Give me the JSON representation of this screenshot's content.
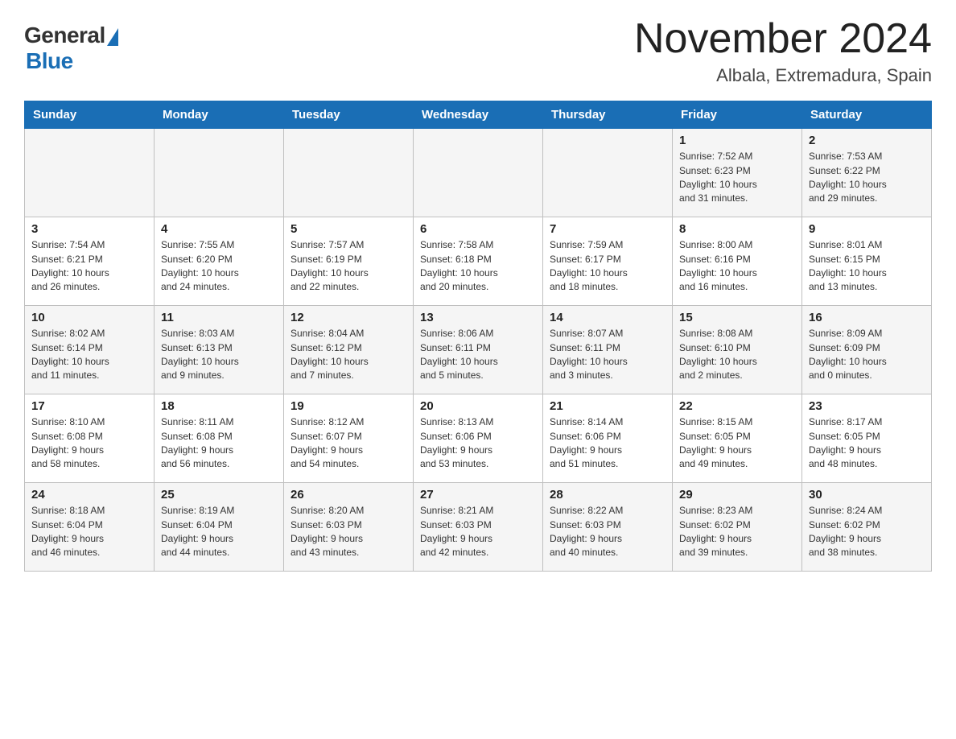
{
  "logo": {
    "general": "General",
    "blue": "Blue"
  },
  "calendar": {
    "title": "November 2024",
    "subtitle": "Albala, Extremadura, Spain"
  },
  "weekdays": [
    "Sunday",
    "Monday",
    "Tuesday",
    "Wednesday",
    "Thursday",
    "Friday",
    "Saturday"
  ],
  "weeks": [
    [
      {
        "day": "",
        "info": ""
      },
      {
        "day": "",
        "info": ""
      },
      {
        "day": "",
        "info": ""
      },
      {
        "day": "",
        "info": ""
      },
      {
        "day": "",
        "info": ""
      },
      {
        "day": "1",
        "info": "Sunrise: 7:52 AM\nSunset: 6:23 PM\nDaylight: 10 hours\nand 31 minutes."
      },
      {
        "day": "2",
        "info": "Sunrise: 7:53 AM\nSunset: 6:22 PM\nDaylight: 10 hours\nand 29 minutes."
      }
    ],
    [
      {
        "day": "3",
        "info": "Sunrise: 7:54 AM\nSunset: 6:21 PM\nDaylight: 10 hours\nand 26 minutes."
      },
      {
        "day": "4",
        "info": "Sunrise: 7:55 AM\nSunset: 6:20 PM\nDaylight: 10 hours\nand 24 minutes."
      },
      {
        "day": "5",
        "info": "Sunrise: 7:57 AM\nSunset: 6:19 PM\nDaylight: 10 hours\nand 22 minutes."
      },
      {
        "day": "6",
        "info": "Sunrise: 7:58 AM\nSunset: 6:18 PM\nDaylight: 10 hours\nand 20 minutes."
      },
      {
        "day": "7",
        "info": "Sunrise: 7:59 AM\nSunset: 6:17 PM\nDaylight: 10 hours\nand 18 minutes."
      },
      {
        "day": "8",
        "info": "Sunrise: 8:00 AM\nSunset: 6:16 PM\nDaylight: 10 hours\nand 16 minutes."
      },
      {
        "day": "9",
        "info": "Sunrise: 8:01 AM\nSunset: 6:15 PM\nDaylight: 10 hours\nand 13 minutes."
      }
    ],
    [
      {
        "day": "10",
        "info": "Sunrise: 8:02 AM\nSunset: 6:14 PM\nDaylight: 10 hours\nand 11 minutes."
      },
      {
        "day": "11",
        "info": "Sunrise: 8:03 AM\nSunset: 6:13 PM\nDaylight: 10 hours\nand 9 minutes."
      },
      {
        "day": "12",
        "info": "Sunrise: 8:04 AM\nSunset: 6:12 PM\nDaylight: 10 hours\nand 7 minutes."
      },
      {
        "day": "13",
        "info": "Sunrise: 8:06 AM\nSunset: 6:11 PM\nDaylight: 10 hours\nand 5 minutes."
      },
      {
        "day": "14",
        "info": "Sunrise: 8:07 AM\nSunset: 6:11 PM\nDaylight: 10 hours\nand 3 minutes."
      },
      {
        "day": "15",
        "info": "Sunrise: 8:08 AM\nSunset: 6:10 PM\nDaylight: 10 hours\nand 2 minutes."
      },
      {
        "day": "16",
        "info": "Sunrise: 8:09 AM\nSunset: 6:09 PM\nDaylight: 10 hours\nand 0 minutes."
      }
    ],
    [
      {
        "day": "17",
        "info": "Sunrise: 8:10 AM\nSunset: 6:08 PM\nDaylight: 9 hours\nand 58 minutes."
      },
      {
        "day": "18",
        "info": "Sunrise: 8:11 AM\nSunset: 6:08 PM\nDaylight: 9 hours\nand 56 minutes."
      },
      {
        "day": "19",
        "info": "Sunrise: 8:12 AM\nSunset: 6:07 PM\nDaylight: 9 hours\nand 54 minutes."
      },
      {
        "day": "20",
        "info": "Sunrise: 8:13 AM\nSunset: 6:06 PM\nDaylight: 9 hours\nand 53 minutes."
      },
      {
        "day": "21",
        "info": "Sunrise: 8:14 AM\nSunset: 6:06 PM\nDaylight: 9 hours\nand 51 minutes."
      },
      {
        "day": "22",
        "info": "Sunrise: 8:15 AM\nSunset: 6:05 PM\nDaylight: 9 hours\nand 49 minutes."
      },
      {
        "day": "23",
        "info": "Sunrise: 8:17 AM\nSunset: 6:05 PM\nDaylight: 9 hours\nand 48 minutes."
      }
    ],
    [
      {
        "day": "24",
        "info": "Sunrise: 8:18 AM\nSunset: 6:04 PM\nDaylight: 9 hours\nand 46 minutes."
      },
      {
        "day": "25",
        "info": "Sunrise: 8:19 AM\nSunset: 6:04 PM\nDaylight: 9 hours\nand 44 minutes."
      },
      {
        "day": "26",
        "info": "Sunrise: 8:20 AM\nSunset: 6:03 PM\nDaylight: 9 hours\nand 43 minutes."
      },
      {
        "day": "27",
        "info": "Sunrise: 8:21 AM\nSunset: 6:03 PM\nDaylight: 9 hours\nand 42 minutes."
      },
      {
        "day": "28",
        "info": "Sunrise: 8:22 AM\nSunset: 6:03 PM\nDaylight: 9 hours\nand 40 minutes."
      },
      {
        "day": "29",
        "info": "Sunrise: 8:23 AM\nSunset: 6:02 PM\nDaylight: 9 hours\nand 39 minutes."
      },
      {
        "day": "30",
        "info": "Sunrise: 8:24 AM\nSunset: 6:02 PM\nDaylight: 9 hours\nand 38 minutes."
      }
    ]
  ]
}
